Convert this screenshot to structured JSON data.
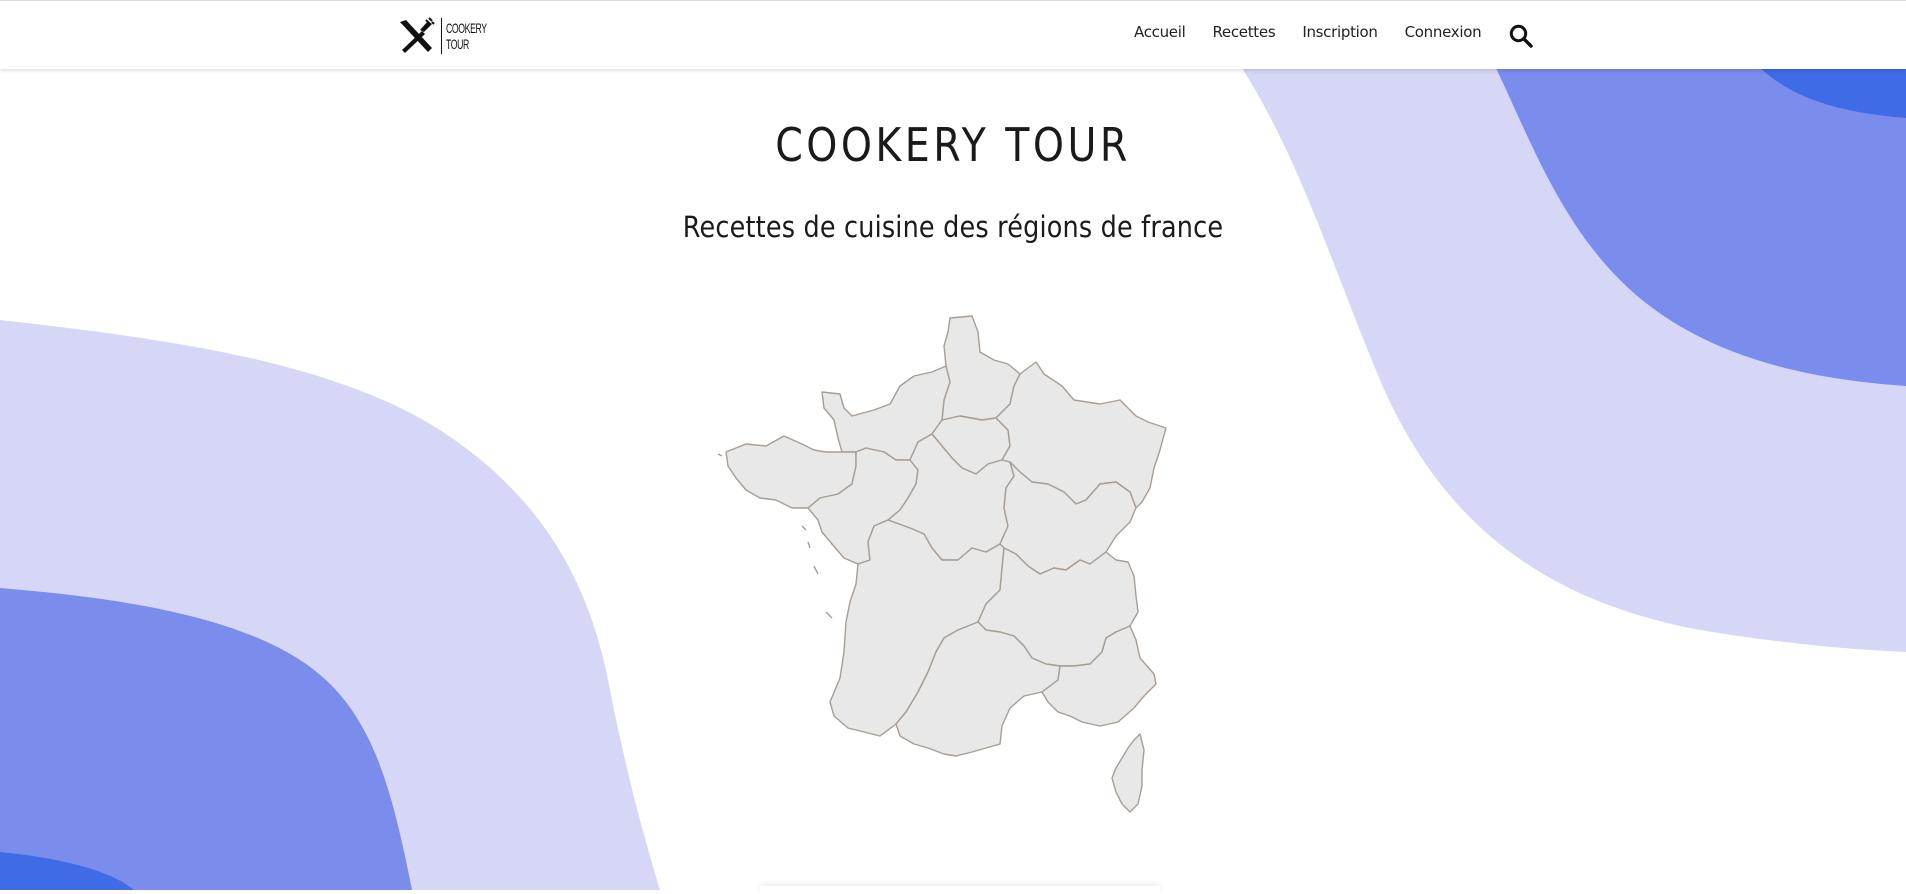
{
  "colors": {
    "wave_light": "#d6d7f6",
    "wave_mid": "#7a8cec",
    "wave_dark": "#3f6be6",
    "map_fill": "#e8e8e8",
    "map_stroke": "#a89d93"
  },
  "nav": {
    "logo_line1": "COOKERY",
    "logo_line2": "TOUR",
    "logo_icon": "utensils-crossed-icon",
    "links": [
      "Accueil",
      "Recettes",
      "Inscription",
      "Connexion"
    ],
    "search_icon": "search-icon"
  },
  "hero": {
    "title": "COOKERY TOUR",
    "subtitle": "Recettes de cuisine des régions de france"
  },
  "map": {
    "regions": [
      "hauts-de-france",
      "normandie",
      "ile-de-france",
      "grand-est",
      "bretagne",
      "pays-de-la-loire",
      "centre-val-de-loire",
      "bourgogne-franche-comte",
      "nouvelle-aquitaine",
      "auvergne-rhone-alpes",
      "occitanie",
      "provence-alpes-cote-d-azur",
      "corse"
    ]
  }
}
